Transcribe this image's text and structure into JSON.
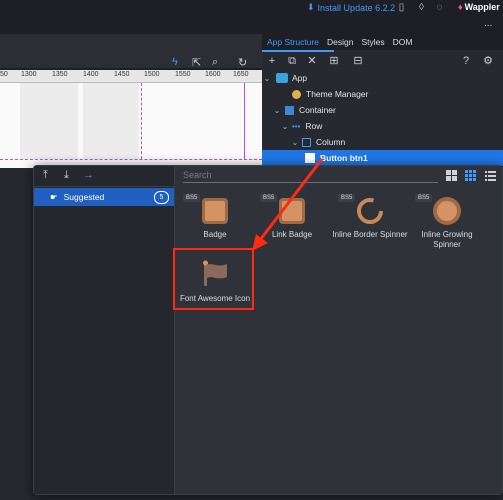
{
  "topbar": {
    "update_label": "Install Update 6.2.2",
    "brand": "Wappler"
  },
  "toolbar2": {
    "more_label": "..."
  },
  "ruler": {
    "ticks": [
      "50",
      "1300",
      "1350",
      "1400",
      "1450",
      "1500",
      "1550",
      "1600",
      "1650"
    ]
  },
  "right_panel": {
    "tabs": [
      {
        "label": "App Structure",
        "active": true
      },
      {
        "label": "Design"
      },
      {
        "label": "Styles"
      },
      {
        "label": "DOM"
      }
    ],
    "tree": [
      {
        "label": "App",
        "icon": "cube-icon"
      },
      {
        "label": "Theme Manager",
        "icon": "palette-icon"
      },
      {
        "label": "Container",
        "icon": "container-icon"
      },
      {
        "label": "Row",
        "icon": "row-icon"
      },
      {
        "label": "Column",
        "icon": "column-icon"
      },
      {
        "label": "Button btn1",
        "icon": "button-icon",
        "selected": true
      }
    ]
  },
  "dialog": {
    "sidebar": {
      "suggested_label": "Suggested",
      "suggested_count": "5"
    },
    "search_placeholder": "Search",
    "components": [
      {
        "badge": "BS5",
        "label": "Badge"
      },
      {
        "badge": "BS5",
        "label": "Link Badge"
      },
      {
        "badge": "BS5",
        "label": "Inline Border Spinner"
      },
      {
        "badge": "BS5",
        "label": "Inline Growing Spinner"
      },
      {
        "badge": "",
        "label": "Font Awesome Icon"
      }
    ]
  },
  "colors": {
    "accent": "#3e9bff",
    "selection": "#1f77e6",
    "highlight": "#ff2a12",
    "component": "#c9875a"
  }
}
